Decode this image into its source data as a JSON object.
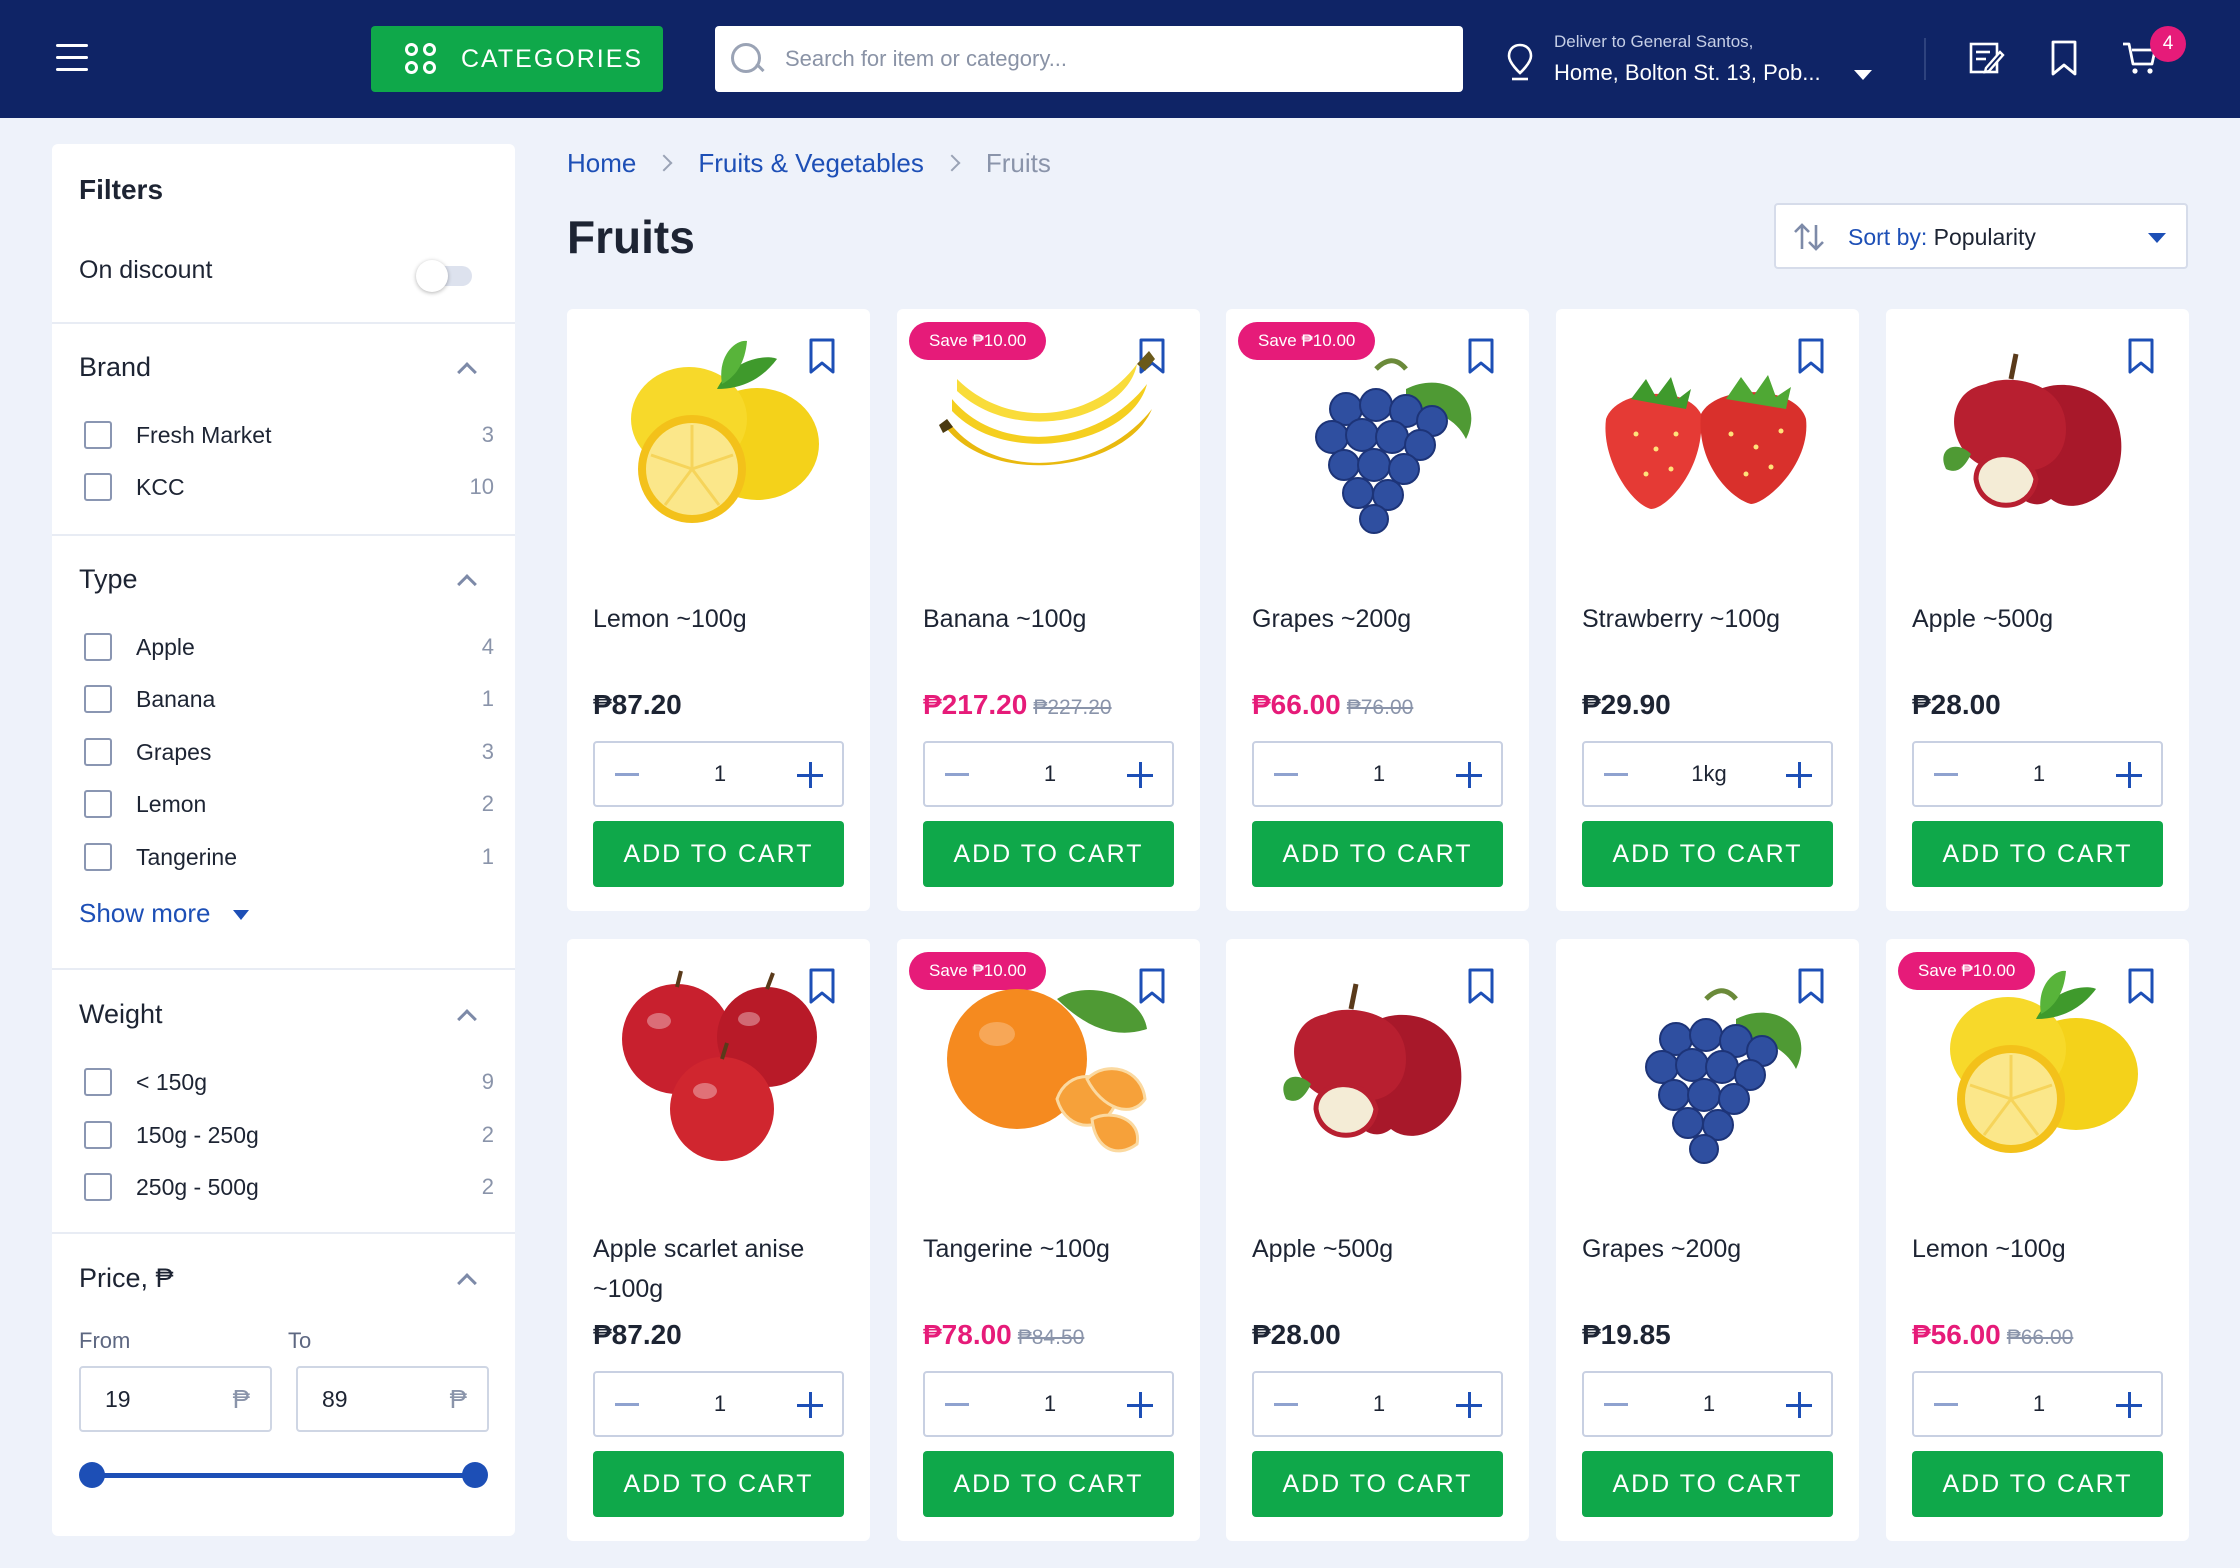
{
  "header": {
    "categories_label": "CATEGORIES",
    "search_placeholder": "Search for item or category...",
    "deliver_small": "Deliver to General Santos,",
    "deliver_address": "Home, Bolton St. 13, Pob...",
    "cart_count": "4",
    "colors": {
      "bar": "#0f2466",
      "accent": "#0fa84a",
      "badge": "#e61b79"
    }
  },
  "sidebar": {
    "title": "Filters",
    "discount_label": "On discount",
    "discount_on": false,
    "brand": {
      "title": "Brand",
      "items": [
        {
          "label": "Fresh Market",
          "count": "3"
        },
        {
          "label": "KCC",
          "count": "10"
        }
      ]
    },
    "type": {
      "title": "Type",
      "items": [
        {
          "label": "Apple",
          "count": "4"
        },
        {
          "label": "Banana",
          "count": "1"
        },
        {
          "label": "Grapes",
          "count": "3"
        },
        {
          "label": "Lemon",
          "count": "2"
        },
        {
          "label": "Tangerine",
          "count": "1"
        }
      ],
      "show_more": "Show more"
    },
    "weight": {
      "title": "Weight",
      "items": [
        {
          "label": "< 150g",
          "count": "9"
        },
        {
          "label": "150g - 250g",
          "count": "2"
        },
        {
          "label": "250g - 500g",
          "count": "2"
        }
      ]
    },
    "price": {
      "title": "Price, ₱",
      "from_label": "From",
      "to_label": "To",
      "from_value": "19",
      "to_value": "89",
      "currency": "₱"
    }
  },
  "main": {
    "breadcrumb": [
      "Home",
      "Fruits & Vegetables",
      "Fruits"
    ],
    "title": "Fruits",
    "sort_prefix": "Sort by:",
    "sort_value": "Popularity",
    "add_label": "ADD TO CART",
    "products": [
      {
        "name": "Lemon ~100g",
        "price": "₱87.20",
        "old": "",
        "badge": "",
        "qty": "1",
        "fruit": "lemon-icon"
      },
      {
        "name": "Banana ~100g",
        "price": "₱217.20",
        "old": "₱227.20",
        "badge": "Save ₱10.00",
        "qty": "1",
        "fruit": "banana-icon"
      },
      {
        "name": "Grapes ~200g",
        "price": "₱66.00",
        "old": "₱76.00",
        "badge": "Save ₱10.00",
        "qty": "1",
        "fruit": "grapes-icon"
      },
      {
        "name": "Strawberry ~100g",
        "price": "₱29.90",
        "old": "",
        "badge": "",
        "qty": "1kg",
        "fruit": "strawberry-icon"
      },
      {
        "name": "Apple ~500g",
        "price": "₱28.00",
        "old": "",
        "badge": "",
        "qty": "1",
        "fruit": "apple-icon"
      },
      {
        "name": "Apple scarlet anise ~100g",
        "price": "₱87.20",
        "old": "",
        "badge": "",
        "qty": "1",
        "fruit": "apples-icon"
      },
      {
        "name": "Tangerine ~100g",
        "price": "₱78.00",
        "old": "₱84.50",
        "badge": "Save ₱10.00",
        "qty": "1",
        "fruit": "tangerine-icon"
      },
      {
        "name": "Apple ~500g",
        "price": "₱28.00",
        "old": "",
        "badge": "",
        "qty": "1",
        "fruit": "apple-icon"
      },
      {
        "name": "Grapes ~200g",
        "price": "₱19.85",
        "old": "",
        "badge": "",
        "qty": "1",
        "fruit": "grapes-icon"
      },
      {
        "name": "Lemon ~100g",
        "price": "₱56.00",
        "old": "₱66.00",
        "badge": "Save ₱10.00",
        "qty": "1",
        "fruit": "lemon-icon"
      }
    ]
  }
}
